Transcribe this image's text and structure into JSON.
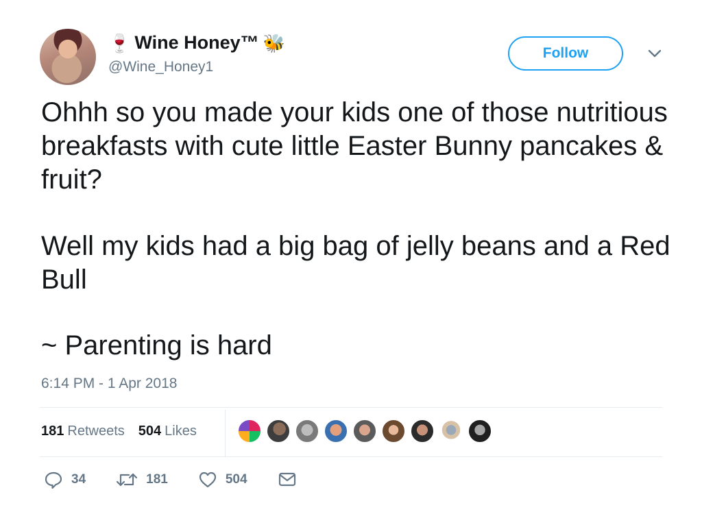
{
  "account": {
    "name_prefix_emoji": "🍷",
    "name": "Wine Honey™",
    "name_suffix_emoji": "🐝",
    "handle": "@Wine_Honey1"
  },
  "follow_label": "Follow",
  "tweet": {
    "paragraphs": [
      "Ohhh so you made your kids one of those nutritious breakfasts with cute little Easter Bunny pancakes & fruit?",
      "Well my kids had a big bag of jelly beans and a Red Bull",
      "~ Parenting is hard"
    ],
    "timestamp": "6:14 PM - 1 Apr 2018"
  },
  "stats": {
    "retweets_count": "181",
    "retweets_label": "Retweets",
    "likes_count": "504",
    "likes_label": "Likes"
  },
  "actions": {
    "reply_count": "34",
    "retweet_count": "181",
    "like_count": "504"
  },
  "icons": [
    "wine-glass-icon",
    "bee-icon",
    "chevron-down-icon",
    "reply-icon",
    "retweet-icon",
    "heart-icon",
    "message-icon"
  ],
  "colors": {
    "accent": "#1da1f2",
    "secondary_text": "#657786",
    "primary_text": "#14171a",
    "divider": "#e6ecf0"
  }
}
